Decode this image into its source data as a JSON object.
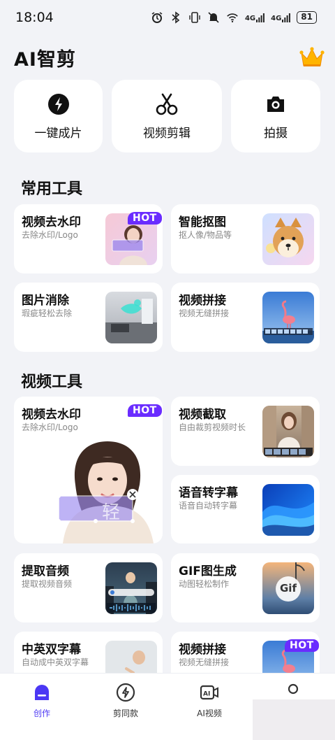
{
  "status_bar": {
    "time": "18:04",
    "network_1": "4G",
    "network_2": "4G",
    "battery": "81",
    "icons": [
      "alarm-icon",
      "bluetooth-icon",
      "vibrate-icon",
      "mute-icon",
      "wifi-icon",
      "signal-icon",
      "signal-icon",
      "battery-icon"
    ]
  },
  "header": {
    "title": "AI智剪",
    "vip_icon": "crown-icon"
  },
  "quick_actions": [
    {
      "label": "一键成片",
      "icon": "lightning-icon"
    },
    {
      "label": "视频剪辑",
      "icon": "scissors-icon"
    },
    {
      "label": "拍摄",
      "icon": "camera-icon"
    }
  ],
  "common_tools": {
    "title": "常用工具",
    "items": [
      {
        "title": "视频去水印",
        "subtitle": "去除水印/Logo",
        "badge": "HOT",
        "thumb": "watermark-thumb"
      },
      {
        "title": "智能抠图",
        "subtitle": "抠人像/物品等",
        "thumb": "shiba-dog-thumb"
      },
      {
        "title": "图片消除",
        "subtitle": "瑕疵轻松去除",
        "thumb": "room-erase-thumb"
      },
      {
        "title": "视频拼接",
        "subtitle": "视频无缝拼接",
        "thumb": "flamingo-thumb"
      }
    ]
  },
  "video_tools": {
    "title": "视频工具",
    "items": [
      {
        "title": "视频去水印",
        "subtitle": "去除水印/Logo",
        "badge": "HOT",
        "thumb": "portrait-thumb",
        "overlay_text": "轻"
      },
      {
        "title": "视频截取",
        "subtitle": "自由裁剪视频时长",
        "thumb": "street-girl-thumb"
      },
      {
        "title": "语音转字幕",
        "subtitle": "语音自动转字幕",
        "thumb": "blue-waves-thumb"
      },
      {
        "title": "提取音频",
        "subtitle": "提取视频音频",
        "thumb": "city-audio-thumb"
      },
      {
        "title": "GIF图生成",
        "subtitle": "动图轻松制作",
        "thumb": "gif-thumb",
        "thumb_text": "Gif"
      },
      {
        "title": "中英双字幕",
        "subtitle": "自动成中英双字幕",
        "thumb": "man-subtitle-thumb"
      },
      {
        "title": "视频拼接",
        "subtitle": "视频无缝拼接",
        "badge": "HOT",
        "thumb": "flamingo-thumb"
      }
    ]
  },
  "bottom_nav": {
    "items": [
      {
        "label": "创作",
        "icon": "create-icon",
        "active": true
      },
      {
        "label": "剪同款",
        "icon": "template-icon",
        "active": false
      },
      {
        "label": "AI视频",
        "icon": "ai-video-icon",
        "active": false
      },
      {
        "label": "",
        "icon": "profile-icon",
        "active": false
      }
    ]
  },
  "colors": {
    "accent": "#4b37f4",
    "hot_badge": "#6a2cff",
    "background": "#f2f3f7",
    "card": "#ffffff"
  }
}
